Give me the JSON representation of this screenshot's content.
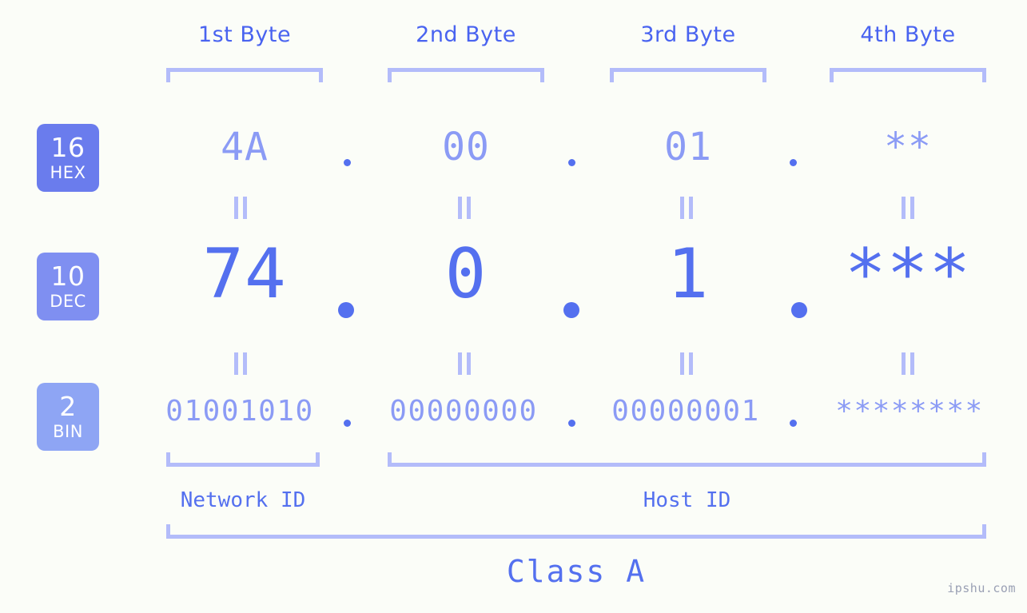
{
  "header": {
    "byte_labels": [
      "1st Byte",
      "2nd Byte",
      "3rd Byte",
      "4th Byte"
    ]
  },
  "bases": [
    {
      "number": "16",
      "name": "HEX",
      "color": "#6a7ced"
    },
    {
      "number": "10",
      "name": "DEC",
      "color": "#7f8ff1"
    },
    {
      "number": "2",
      "name": "BIN",
      "color": "#8ea5f4"
    }
  ],
  "rows": {
    "hex": {
      "base_number": "16",
      "base_name": "HEX",
      "values": [
        "4A",
        "00",
        "01",
        "**"
      ],
      "separator": "."
    },
    "dec": {
      "base_number": "10",
      "base_name": "DEC",
      "values": [
        "74",
        "0",
        "1",
        "***"
      ],
      "separator": "."
    },
    "bin": {
      "base_number": "2",
      "base_name": "BIN",
      "values": [
        "01001010",
        "00000000",
        "00000001",
        "********"
      ],
      "separator": "."
    }
  },
  "equals_symbol": "=",
  "sections": [
    {
      "label": "Network ID"
    },
    {
      "label": "Host ID"
    }
  ],
  "class": {
    "label": "Class A"
  },
  "watermark": {
    "text": "ipshu.com"
  },
  "colors": {
    "background": "#fbfdf8",
    "accent_strong": "#4963f0",
    "accent_medium": "#5470ef",
    "accent_light": "#8b9bf5",
    "bracket": "#b3bcfa",
    "badge_hex": "#6a7ced",
    "badge_dec": "#7f8ff1",
    "badge_bin": "#8ea5f4",
    "watermark": "#9aa0b4"
  }
}
